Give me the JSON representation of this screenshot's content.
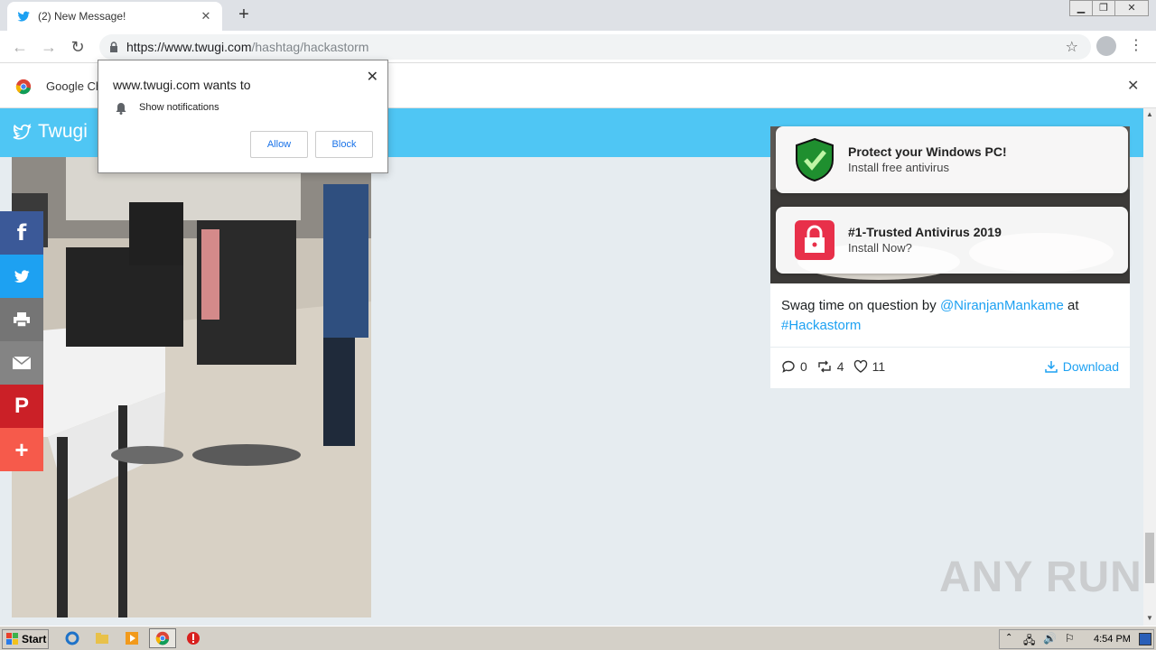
{
  "browser": {
    "tab_title": "(2) New Message!",
    "url_host": "https://www.twugi.com",
    "url_path": "/hashtag/hackastorm",
    "infobar_text": "Google Ch"
  },
  "permission_prompt": {
    "origin_text": "www.twugi.com wants to",
    "permission_label": "Show notifications",
    "allow_label": "Allow",
    "block_label": "Block"
  },
  "site": {
    "brand": "Twugi",
    "accent_color": "#4fc6f4",
    "link_color": "#1da1f2"
  },
  "tweet": {
    "text_prefix": "Swag time on question by ",
    "mention": "@NiranjanMankame",
    "text_mid": " at",
    "hashtag": "#Hackastorm",
    "replies": "0",
    "retweets": "4",
    "likes": "11",
    "download_label": "Download"
  },
  "ads": [
    {
      "title": "Protect your Windows PC!",
      "subtitle": "Install free antivirus"
    },
    {
      "title": "#1-Trusted Antivirus 2019",
      "subtitle": "Install Now?"
    }
  ],
  "share_buttons": [
    {
      "name": "facebook",
      "glyph": "f",
      "color": "#3b5998"
    },
    {
      "name": "twitter",
      "glyph": "",
      "color": "#1da1f2"
    },
    {
      "name": "print",
      "glyph": "",
      "color": "#757575"
    },
    {
      "name": "email",
      "glyph": "",
      "color": "#848484"
    },
    {
      "name": "pinterest",
      "glyph": "P",
      "color": "#cb2027"
    },
    {
      "name": "more",
      "glyph": "+",
      "color": "#f65a4b"
    }
  ],
  "taskbar": {
    "start_label": "Start",
    "clock": "4:54 PM"
  },
  "watermark": "ANY RUN"
}
